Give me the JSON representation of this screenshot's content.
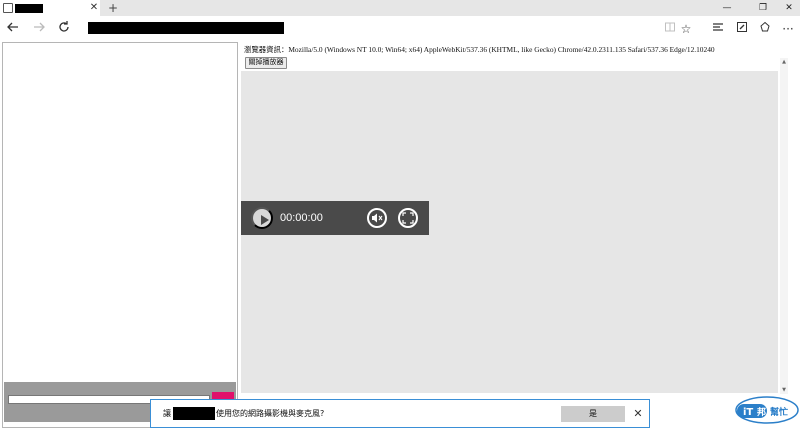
{
  "browser": {
    "tab": {
      "title": "",
      "close": "✕"
    },
    "new_tab": "+",
    "window_controls": {
      "minimize": "—",
      "restore": "❐",
      "close": "✕"
    },
    "address_bar": {
      "value": ""
    },
    "icons": [
      "back-icon",
      "forward-icon",
      "refresh-icon",
      "reading-view-icon",
      "favorites-star-icon",
      "hub-icon",
      "web-note-icon",
      "share-icon",
      "more-icon"
    ]
  },
  "page": {
    "user_agent": "瀏覽器資訊：Mozilla/5.0 (Windows NT 10.0; Win64; x64) AppleWebKit/537.36 (KHTML, like Gecko) Chrome/42.0.2311.135 Safari/537.36 Edge/12.10240",
    "close_player_label": "關掉播放器",
    "player": {
      "time": "00:00:00"
    },
    "chat_input": {
      "value": ""
    }
  },
  "permission_bar": {
    "prefix": "讓",
    "site": "",
    "message": "使用您的網路攝影機與麥克風?",
    "yes_label": "是",
    "close": "✕"
  },
  "logo": {
    "text": "iT邦幫忙"
  },
  "colors": {
    "accent": "#3a8fd6",
    "send_button": "#e0106b",
    "player_bg": "#4a4a4a"
  }
}
